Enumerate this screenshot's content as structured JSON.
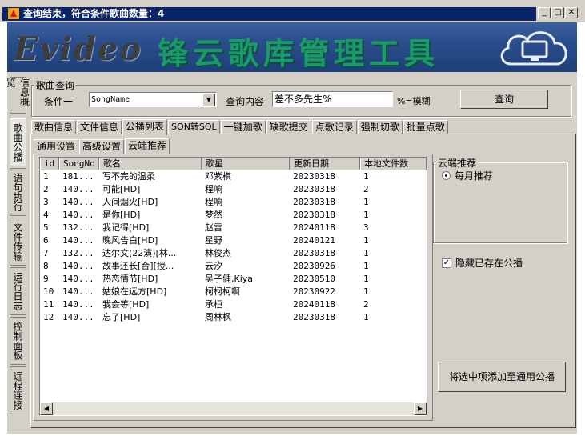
{
  "window": {
    "title": "查询结束，符合条件歌曲数量：4",
    "minimize": "_",
    "maximize": "□",
    "close": "✕"
  },
  "banner": {
    "logo_text": "Evideo",
    "app_title": "锋云歌库管理工具"
  },
  "side_tabs": [
    "信息概览",
    "歌曲公播",
    "语句执行",
    "文件传输",
    "运行日志",
    "控制面板",
    "远程连接"
  ],
  "query": {
    "group_label": "歌曲查询",
    "condition_label": "条件一",
    "condition_value": "SongName",
    "content_label": "查询内容",
    "content_value": "差不多先生%",
    "fuzzy_hint": "%=模糊",
    "query_button": "查询"
  },
  "tabs": [
    "歌曲信息",
    "文件信息",
    "公播列表",
    "SON转SQL",
    "一键加歌",
    "缺歌提交",
    "点歌记录",
    "强制切歌",
    "批量点歌"
  ],
  "active_tab": "公播列表",
  "sub_tabs": [
    "通用设置",
    "高级设置",
    "云端推荐"
  ],
  "active_sub_tab": "云端推荐",
  "table": {
    "columns": [
      "id",
      "SongNo",
      "歌名",
      "歌星",
      "更新日期",
      "本地文件数"
    ],
    "rows": [
      [
        "1",
        "181...",
        "写不完的温柔",
        "邓紫棋",
        "20230318",
        "1"
      ],
      [
        "2",
        "140...",
        "可能[HD]",
        "程响",
        "20230318",
        "2"
      ],
      [
        "3",
        "140...",
        "人间烟火[HD]",
        "程响",
        "20230318",
        "1"
      ],
      [
        "4",
        "140...",
        "是你[HD]",
        "梦然",
        "20230318",
        "1"
      ],
      [
        "5",
        "132...",
        "我记得[HD]",
        "赵雷",
        "20240118",
        "3"
      ],
      [
        "6",
        "140...",
        "晚风告白[HD]",
        "星野",
        "20240121",
        "1"
      ],
      [
        "7",
        "132...",
        "达尔文(22演)[林...",
        "林俊杰",
        "20230318",
        "1"
      ],
      [
        "8",
        "140...",
        "故事还长[合][授...",
        "云汐",
        "20230926",
        "1"
      ],
      [
        "9",
        "140...",
        "热恋情节[HD]",
        "吴子健,Kiya",
        "20230510",
        "1"
      ],
      [
        "10",
        "140...",
        "姑娘在远方[HD]",
        "柯柯柯啊",
        "20230922",
        "1"
      ],
      [
        "11",
        "140...",
        "我会等[HD]",
        "承桓",
        "20240118",
        "2"
      ],
      [
        "12",
        "140...",
        "忘了[HD]",
        "周林枫",
        "20230318",
        "1"
      ]
    ]
  },
  "cloud": {
    "group_label": "云端推荐",
    "radio_label": "每月推荐",
    "hide_checkbox_label": "隐藏已存在公播",
    "add_button": "将选中项添加至通用公播"
  }
}
